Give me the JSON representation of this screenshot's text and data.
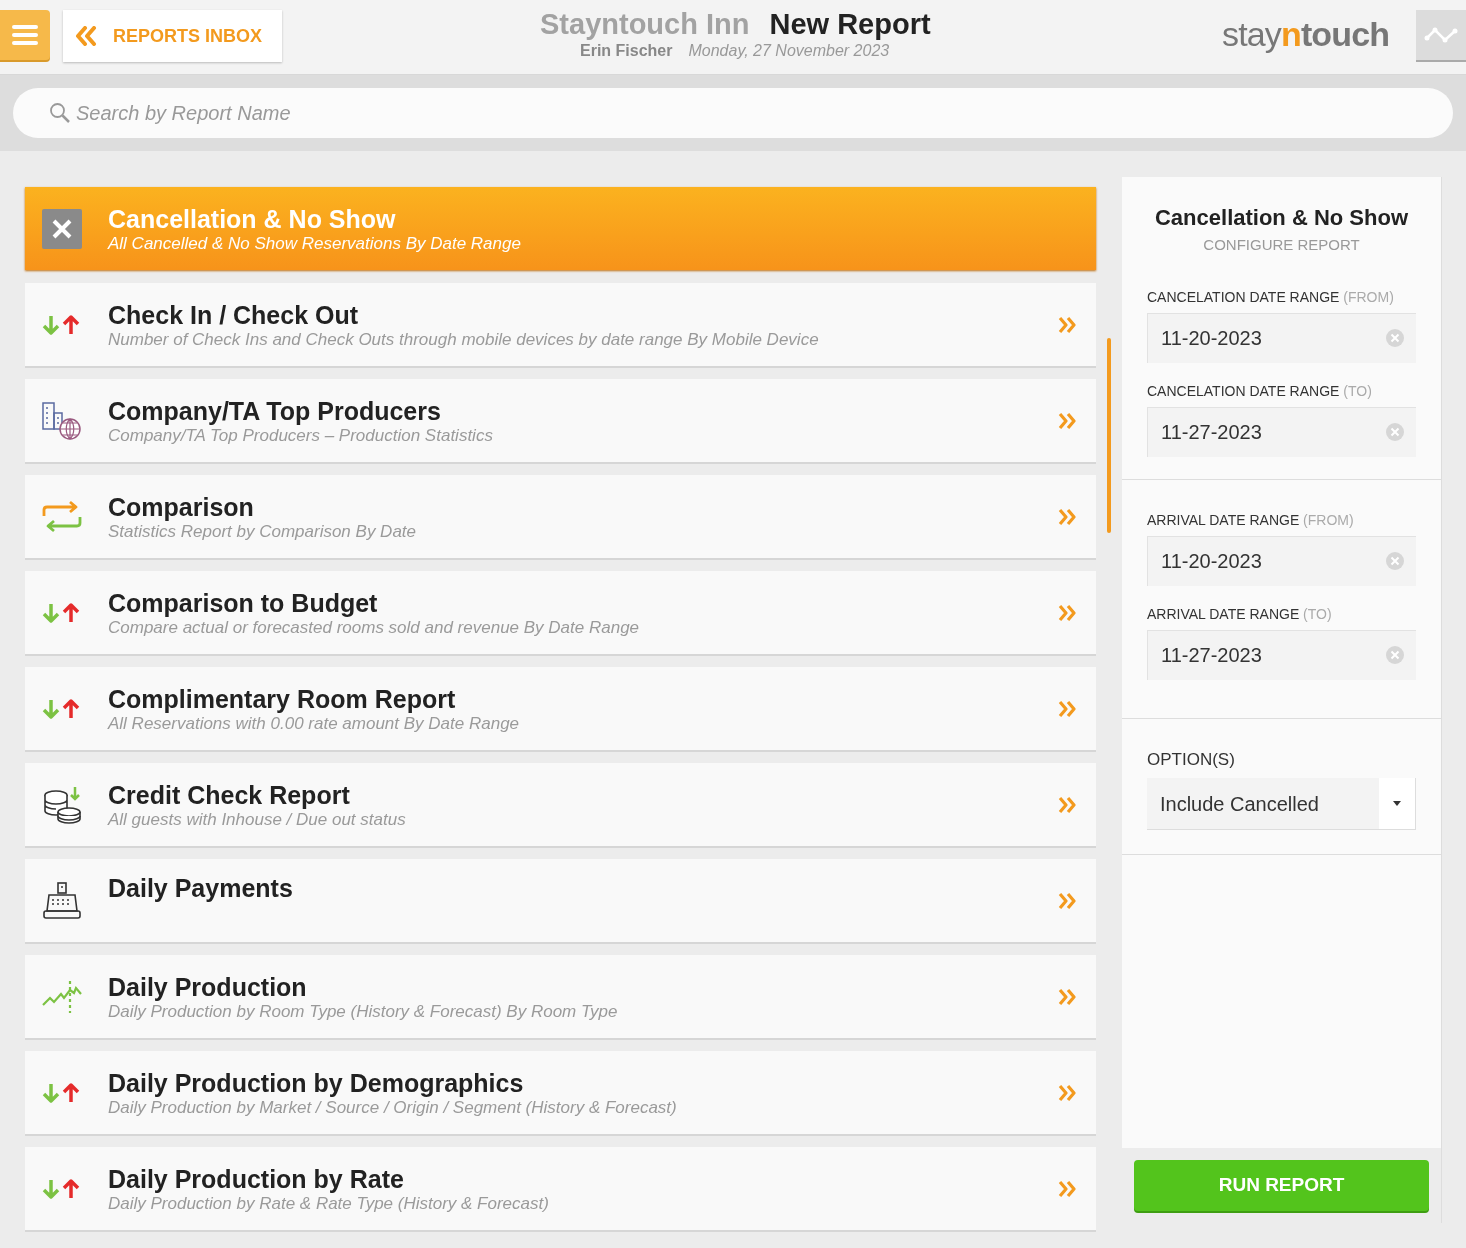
{
  "header": {
    "back_button": "REPORTS INBOX",
    "hotel": "Stayntouch Inn",
    "page_title": "New Report",
    "user": "Erin Fischer",
    "date": "Monday, 27 November 2023",
    "logo": [
      "stay",
      "n",
      "touch"
    ]
  },
  "search": {
    "placeholder": "Search by Report Name"
  },
  "reports": [
    {
      "title": "Cancellation & No Show",
      "subtitle": "All Cancelled & No Show Reservations By Date Range",
      "kind": "close",
      "selected": true
    },
    {
      "title": "Check In / Check Out",
      "subtitle": "Number of Check Ins and Check Outs through mobile devices by date range By Mobile Device",
      "kind": "arrows",
      "selected": false
    },
    {
      "title": "Company/TA Top Producers",
      "subtitle": "Company/TA Top Producers – Production Statistics",
      "kind": "buildings",
      "selected": false
    },
    {
      "title": "Comparison",
      "subtitle": "Statistics Report by Comparison By Date",
      "kind": "swap",
      "selected": false
    },
    {
      "title": "Comparison to Budget",
      "subtitle": "Compare actual or forecasted rooms sold and revenue By Date Range",
      "kind": "arrows",
      "selected": false
    },
    {
      "title": "Complimentary Room Report",
      "subtitle": "All Reservations with 0.00 rate amount By Date Range",
      "kind": "arrows",
      "selected": false
    },
    {
      "title": "Credit Check Report",
      "subtitle": "All guests with Inhouse / Due out status",
      "kind": "coins",
      "selected": false
    },
    {
      "title": "Daily Payments",
      "kind": "register",
      "selected": false
    },
    {
      "title": "Daily Production",
      "subtitle": "Daily Production by Room Type (History & Forecast) By Room Type",
      "kind": "chart",
      "selected": false
    },
    {
      "title": "Daily Production by Demographics",
      "subtitle": "Daily Production by Market / Source / Origin / Segment (History & Forecast)",
      "kind": "arrows",
      "selected": false
    },
    {
      "title": "Daily Production by Rate",
      "subtitle": "Daily Production by Rate & Rate Type (History & Forecast)",
      "kind": "arrows",
      "selected": false
    }
  ],
  "config": {
    "title": "Cancellation & No Show",
    "subtitle": "CONFIGURE REPORT",
    "sections": [
      {
        "fields": [
          {
            "label": "CANCELATION DATE RANGE",
            "qualifier": "(FROM)",
            "value": "11-20-2023"
          },
          {
            "label": "CANCELATION DATE RANGE",
            "qualifier": "(TO)",
            "value": "11-27-2023"
          }
        ]
      },
      {
        "fields": [
          {
            "label": "ARRIVAL DATE RANGE",
            "qualifier": "(FROM)",
            "value": "11-20-2023"
          },
          {
            "label": "ARRIVAL DATE RANGE",
            "qualifier": "(TO)",
            "value": "11-27-2023"
          }
        ]
      }
    ],
    "options": {
      "label": "OPTION(S)",
      "value": "Include Cancelled"
    },
    "run_button": "RUN REPORT"
  }
}
